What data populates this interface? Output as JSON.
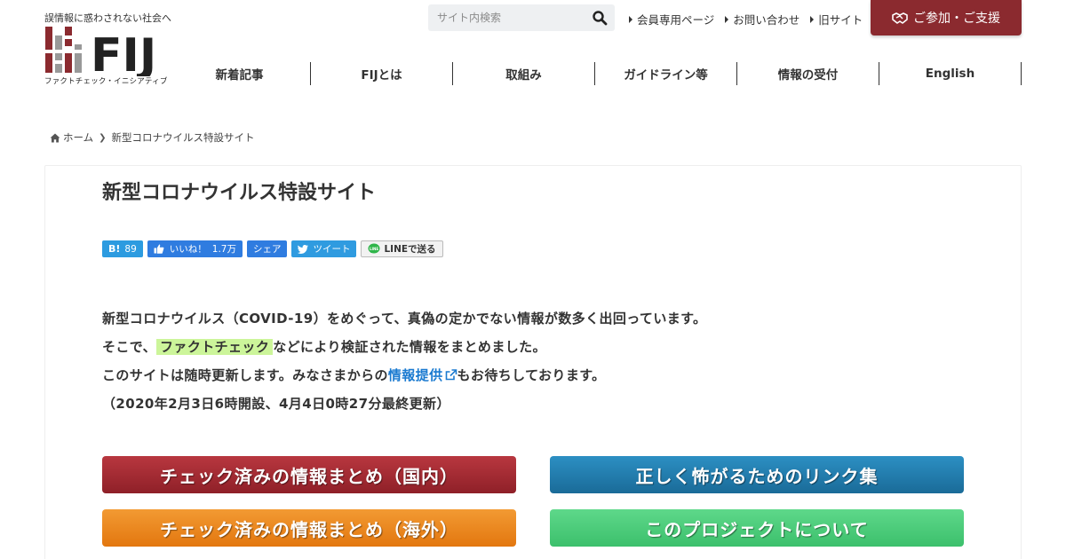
{
  "header": {
    "tagline": "誤情報に惑わされない社会へ",
    "logo_text": "FIJ",
    "logo_sub": "ファクトチェック・イニシアティブ",
    "search_placeholder": "サイト内検索",
    "top_links": [
      "会員専用ページ",
      "お問い合わせ",
      "旧サイト"
    ],
    "support_label": "ご参加・ご支援",
    "brand_color": "#8b2a2f"
  },
  "nav": {
    "items": [
      "新着記事",
      "FIJとは",
      "取組み",
      "ガイドライン等",
      "情報の受付",
      "English"
    ]
  },
  "breadcrumb": {
    "home": "ホーム",
    "current": "新型コロナウイルス特設サイト"
  },
  "article": {
    "title": "新型コロナウイルス特設サイト",
    "share": {
      "hatena_count": "89",
      "like_label": "いいね！",
      "like_count": "1.7万",
      "share_label": "シェア",
      "tweet_label": "ツイート",
      "line_label": "LINEで送る"
    },
    "line1": "新型コロナウイルス（COVID-19）をめぐって、真偽の定かでない情報が数多く出回っています。",
    "line2_pre": "そこで、",
    "line2_hl": "ファクトチェック",
    "line2_post": "などにより検証された情報をまとめました。",
    "line3_pre": "このサイトは随時更新します。みなさまからの",
    "line3_link": "情報提供",
    "line3_post": "もお待ちしております。",
    "updated": "（2020年2月3日6時開設、4月4日0時27分最終更新）",
    "buttons": {
      "domestic": "チェック済みの情報まとめ（国内）",
      "links": "正しく怖がるためのリンク集",
      "overseas": "チェック済みの情報まとめ（海外）",
      "about": "このプロジェクトについて"
    }
  }
}
